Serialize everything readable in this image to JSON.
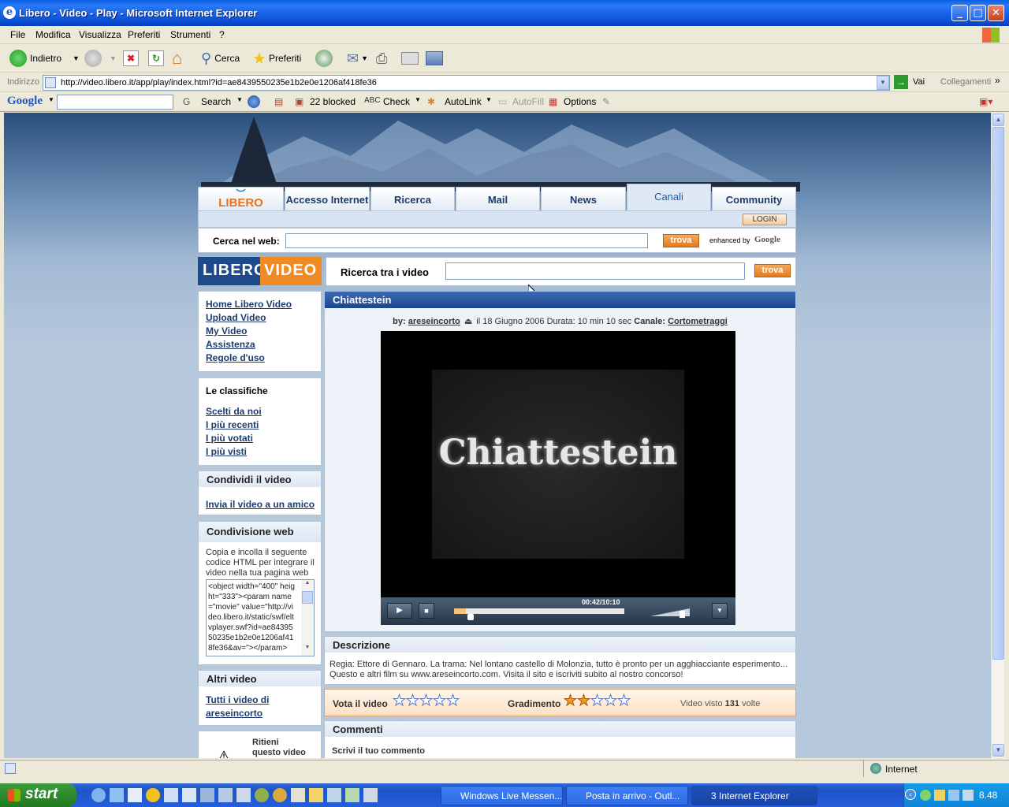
{
  "window": {
    "title": "Libero - Video - Play - Microsoft Internet Explorer"
  },
  "menu": [
    "File",
    "Modifica",
    "Visualizza",
    "Preferiti",
    "Strumenti",
    "?"
  ],
  "toolbar": {
    "back": "Indietro",
    "search": "Cerca",
    "favorites": "Preferiti"
  },
  "address": {
    "label": "Indirizzo",
    "url": "http://video.libero.it/app/play/index.html?id=ae8439550235e1b2e0e1206af418fe36",
    "go": "Vai",
    "links": "Collegamenti"
  },
  "googlebar": {
    "brand": "Google",
    "search": "Search",
    "blocked": "22 blocked",
    "check": "Check",
    "autolink": "AutoLink",
    "autofill": "AutoFill",
    "options": "Options"
  },
  "site": {
    "tabs": [
      "Accesso Internet",
      "Ricerca",
      "Mail",
      "News",
      "Canali",
      "Community"
    ],
    "logo": "LIBERO",
    "login": "LOGIN",
    "web_search_label": "Cerca nel web:",
    "trova": "trova",
    "enhanced": "enhanced by",
    "google": "Google",
    "video_logo_a": "LIBERO",
    "video_logo_b": "VIDEO",
    "video_search_label": "Ricerca tra i video"
  },
  "sidebar": {
    "links": [
      "Home Libero Video",
      "Upload Video",
      "My Video",
      "Assistenza",
      "Regole d'uso"
    ],
    "rank_title": "Le classifiche",
    "rank_links": [
      "Scelti da noi",
      "I più recenti",
      "I più votati",
      "I più visti"
    ],
    "share_title": "Condividi il video",
    "share_link": "Invia il video a un amico",
    "web_share_title": "Condivisione web",
    "web_share_text": "Copia e incolla il seguente codice HTML per integrare il video nella tua pagina web",
    "embed_code": "<object width=\"400\" height=\"333\"><param name=\"movie\" value=\"http://video.libero.it/static/swf/eltvplayer.swf?id=ae8439550235e1b2e0e1206af418fe36&av=\"></param>",
    "other_title": "Altri video",
    "other_link": "Tutti i video di areseincorto",
    "report_text": "Ritieni questo video"
  },
  "video": {
    "title": "Chiattestein",
    "by_label": "by:",
    "author": "areseincorto",
    "date": "il 18 Giugno 2006 Durata: 10 min 10 sec",
    "canale_label": "Canale:",
    "canale": "Cortometraggi",
    "frame_text": "Chiattestein",
    "time": "00:42/10:10",
    "progress": 0.069,
    "volume": 0.8
  },
  "description": {
    "title": "Descrizione",
    "text": "Regia: Ettore di Gennaro. La trama: Nel lontano castello di Molonzia, tutto è pronto per un agghiacciante esperimento... Questo e altri film su www.areseincorto.com. Visita il sito e iscriviti subito al nostro concorso!"
  },
  "rating": {
    "vote_label": "Vota il video",
    "grade_label": "Gradimento",
    "grade": 2,
    "views_prefix": "Video visto",
    "views": "131",
    "views_suffix": "volte"
  },
  "comments": {
    "title": "Commenti",
    "write": "Scrivi il tuo commento"
  },
  "status": {
    "zone": "Internet"
  },
  "taskbar": {
    "start": "start",
    "tasks": [
      "Windows Live Messen...",
      "Posta in arrivo - Outl...",
      "3 Internet Explorer"
    ],
    "clock": "8.48"
  }
}
